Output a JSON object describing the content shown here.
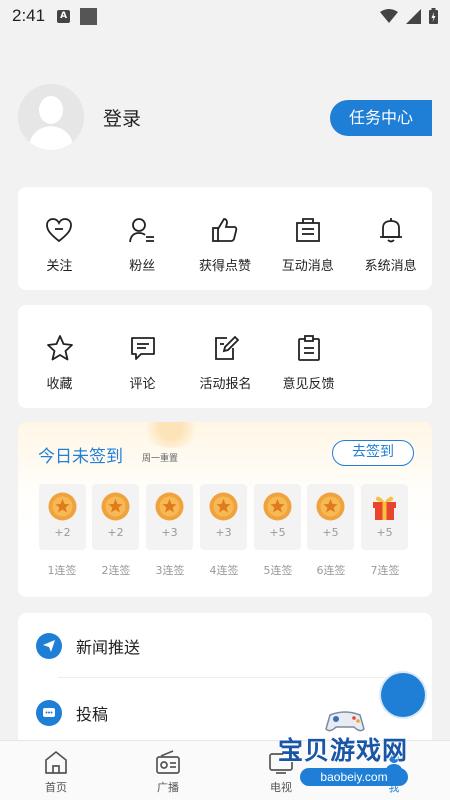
{
  "status_bar": {
    "time": "2:41",
    "notif_icon_letter": "A"
  },
  "profile": {
    "login_label": "登录",
    "task_center_label": "任务中心"
  },
  "shortcuts_row1": [
    {
      "label": "关注",
      "icon": "heart-icon"
    },
    {
      "label": "粉丝",
      "icon": "user-list-icon"
    },
    {
      "label": "获得点赞",
      "icon": "thumbs-up-icon"
    },
    {
      "label": "互动消息",
      "icon": "interaction-message-icon"
    },
    {
      "label": "系统消息",
      "icon": "bell-icon"
    }
  ],
  "shortcuts_row2": [
    {
      "label": "收藏",
      "icon": "star-icon"
    },
    {
      "label": "评论",
      "icon": "comment-icon"
    },
    {
      "label": "活动报名",
      "icon": "edit-doc-icon"
    },
    {
      "label": "意见反馈",
      "icon": "clipboard-icon"
    }
  ],
  "signin": {
    "title": "今日未签到",
    "subtitle": "周一重置",
    "button_label": "去签到",
    "days": [
      {
        "points": "+2",
        "label": "1连签",
        "reward": "coin"
      },
      {
        "points": "+2",
        "label": "2连签",
        "reward": "coin"
      },
      {
        "points": "+3",
        "label": "3连签",
        "reward": "coin"
      },
      {
        "points": "+3",
        "label": "4连签",
        "reward": "coin"
      },
      {
        "points": "+5",
        "label": "5连签",
        "reward": "coin"
      },
      {
        "points": "+5",
        "label": "6连签",
        "reward": "coin"
      },
      {
        "points": "+5",
        "label": "7连签",
        "reward": "gift"
      }
    ]
  },
  "menu_list": [
    {
      "label": "新闻推送",
      "icon": "paper-plane-icon"
    },
    {
      "label": "投稿",
      "icon": "chat-bubble-icon"
    }
  ],
  "tabbar": [
    {
      "label": "首页",
      "icon": "home-icon"
    },
    {
      "label": "广播",
      "icon": "radio-icon"
    },
    {
      "label": "电视",
      "icon": "tv-icon"
    },
    {
      "label": "我",
      "icon": "me-icon",
      "active": true
    }
  ],
  "watermark": {
    "text": "宝贝游戏网",
    "url": "baobeiy.com"
  },
  "colors": {
    "accent": "#1f7fd6",
    "coin": "#f0a23c",
    "gift": "#e8442e"
  }
}
